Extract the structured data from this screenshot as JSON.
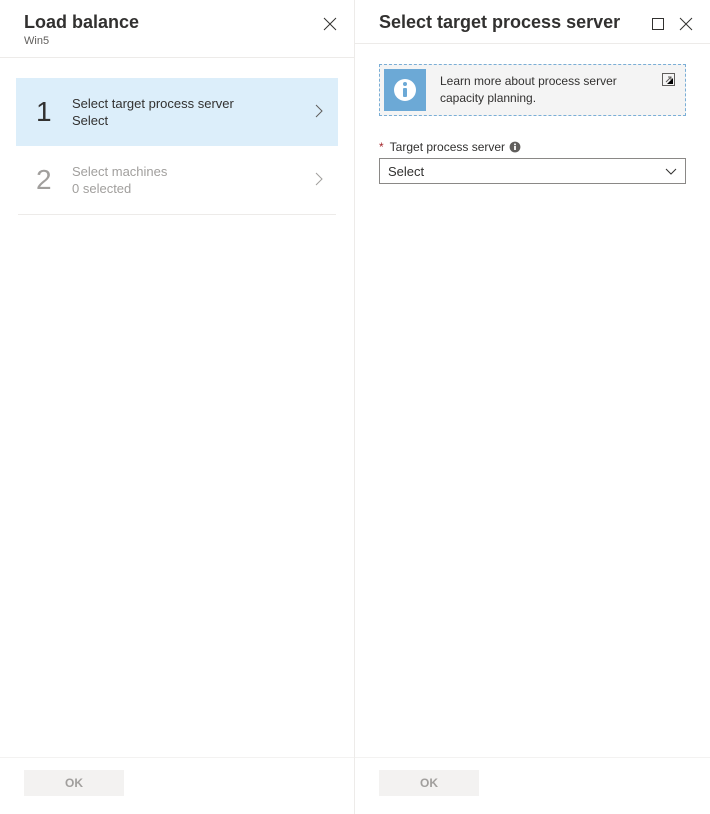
{
  "left_panel": {
    "title": "Load balance",
    "subtitle": "Win5",
    "steps": [
      {
        "number": "1",
        "title": "Select target process server",
        "sub": "Select"
      },
      {
        "number": "2",
        "title": "Select machines",
        "sub": "0 selected"
      }
    ],
    "ok_label": "OK"
  },
  "right_panel": {
    "title": "Select target process server",
    "info_text": "Learn more about process server capacity planning.",
    "field": {
      "label": "Target process server",
      "value": "Select"
    },
    "ok_label": "OK"
  }
}
